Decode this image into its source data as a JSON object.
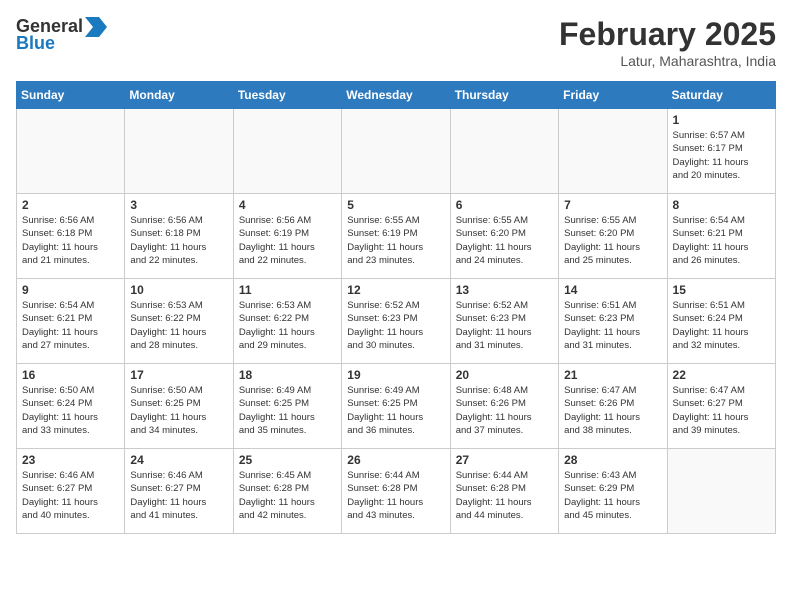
{
  "header": {
    "logo_line1": "General",
    "logo_line2": "Blue",
    "month_title": "February 2025",
    "location": "Latur, Maharashtra, India"
  },
  "days_of_week": [
    "Sunday",
    "Monday",
    "Tuesday",
    "Wednesday",
    "Thursday",
    "Friday",
    "Saturday"
  ],
  "weeks": [
    [
      {
        "day": "",
        "info": ""
      },
      {
        "day": "",
        "info": ""
      },
      {
        "day": "",
        "info": ""
      },
      {
        "day": "",
        "info": ""
      },
      {
        "day": "",
        "info": ""
      },
      {
        "day": "",
        "info": ""
      },
      {
        "day": "1",
        "info": "Sunrise: 6:57 AM\nSunset: 6:17 PM\nDaylight: 11 hours\nand 20 minutes."
      }
    ],
    [
      {
        "day": "2",
        "info": "Sunrise: 6:56 AM\nSunset: 6:18 PM\nDaylight: 11 hours\nand 21 minutes."
      },
      {
        "day": "3",
        "info": "Sunrise: 6:56 AM\nSunset: 6:18 PM\nDaylight: 11 hours\nand 22 minutes."
      },
      {
        "day": "4",
        "info": "Sunrise: 6:56 AM\nSunset: 6:19 PM\nDaylight: 11 hours\nand 22 minutes."
      },
      {
        "day": "5",
        "info": "Sunrise: 6:55 AM\nSunset: 6:19 PM\nDaylight: 11 hours\nand 23 minutes."
      },
      {
        "day": "6",
        "info": "Sunrise: 6:55 AM\nSunset: 6:20 PM\nDaylight: 11 hours\nand 24 minutes."
      },
      {
        "day": "7",
        "info": "Sunrise: 6:55 AM\nSunset: 6:20 PM\nDaylight: 11 hours\nand 25 minutes."
      },
      {
        "day": "8",
        "info": "Sunrise: 6:54 AM\nSunset: 6:21 PM\nDaylight: 11 hours\nand 26 minutes."
      }
    ],
    [
      {
        "day": "9",
        "info": "Sunrise: 6:54 AM\nSunset: 6:21 PM\nDaylight: 11 hours\nand 27 minutes."
      },
      {
        "day": "10",
        "info": "Sunrise: 6:53 AM\nSunset: 6:22 PM\nDaylight: 11 hours\nand 28 minutes."
      },
      {
        "day": "11",
        "info": "Sunrise: 6:53 AM\nSunset: 6:22 PM\nDaylight: 11 hours\nand 29 minutes."
      },
      {
        "day": "12",
        "info": "Sunrise: 6:52 AM\nSunset: 6:23 PM\nDaylight: 11 hours\nand 30 minutes."
      },
      {
        "day": "13",
        "info": "Sunrise: 6:52 AM\nSunset: 6:23 PM\nDaylight: 11 hours\nand 31 minutes."
      },
      {
        "day": "14",
        "info": "Sunrise: 6:51 AM\nSunset: 6:23 PM\nDaylight: 11 hours\nand 31 minutes."
      },
      {
        "day": "15",
        "info": "Sunrise: 6:51 AM\nSunset: 6:24 PM\nDaylight: 11 hours\nand 32 minutes."
      }
    ],
    [
      {
        "day": "16",
        "info": "Sunrise: 6:50 AM\nSunset: 6:24 PM\nDaylight: 11 hours\nand 33 minutes."
      },
      {
        "day": "17",
        "info": "Sunrise: 6:50 AM\nSunset: 6:25 PM\nDaylight: 11 hours\nand 34 minutes."
      },
      {
        "day": "18",
        "info": "Sunrise: 6:49 AM\nSunset: 6:25 PM\nDaylight: 11 hours\nand 35 minutes."
      },
      {
        "day": "19",
        "info": "Sunrise: 6:49 AM\nSunset: 6:25 PM\nDaylight: 11 hours\nand 36 minutes."
      },
      {
        "day": "20",
        "info": "Sunrise: 6:48 AM\nSunset: 6:26 PM\nDaylight: 11 hours\nand 37 minutes."
      },
      {
        "day": "21",
        "info": "Sunrise: 6:47 AM\nSunset: 6:26 PM\nDaylight: 11 hours\nand 38 minutes."
      },
      {
        "day": "22",
        "info": "Sunrise: 6:47 AM\nSunset: 6:27 PM\nDaylight: 11 hours\nand 39 minutes."
      }
    ],
    [
      {
        "day": "23",
        "info": "Sunrise: 6:46 AM\nSunset: 6:27 PM\nDaylight: 11 hours\nand 40 minutes."
      },
      {
        "day": "24",
        "info": "Sunrise: 6:46 AM\nSunset: 6:27 PM\nDaylight: 11 hours\nand 41 minutes."
      },
      {
        "day": "25",
        "info": "Sunrise: 6:45 AM\nSunset: 6:28 PM\nDaylight: 11 hours\nand 42 minutes."
      },
      {
        "day": "26",
        "info": "Sunrise: 6:44 AM\nSunset: 6:28 PM\nDaylight: 11 hours\nand 43 minutes."
      },
      {
        "day": "27",
        "info": "Sunrise: 6:44 AM\nSunset: 6:28 PM\nDaylight: 11 hours\nand 44 minutes."
      },
      {
        "day": "28",
        "info": "Sunrise: 6:43 AM\nSunset: 6:29 PM\nDaylight: 11 hours\nand 45 minutes."
      },
      {
        "day": "",
        "info": ""
      }
    ]
  ]
}
